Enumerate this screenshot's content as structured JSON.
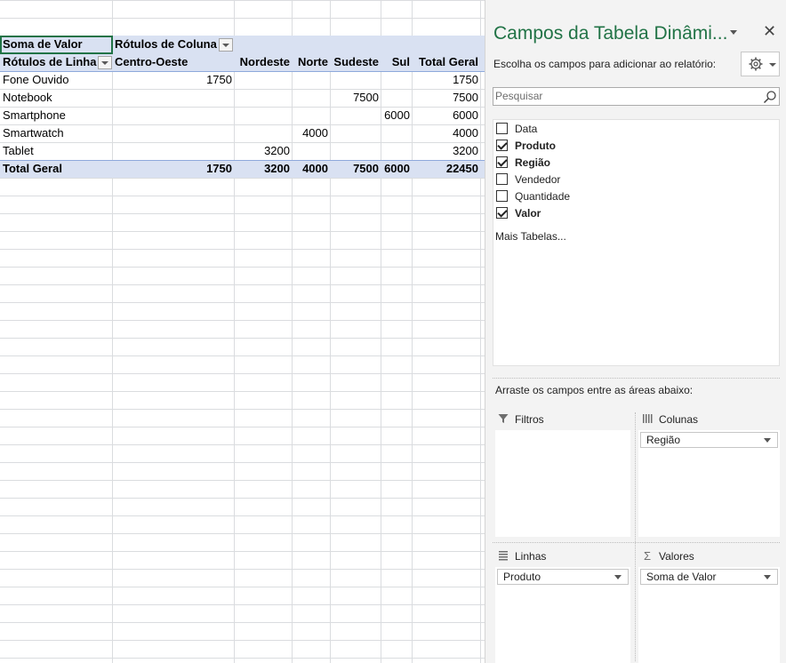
{
  "pivot": {
    "values_header": "Soma de Valor",
    "column_labels_header": "Rótulos de Coluna",
    "row_labels_header": "Rótulos de Linha",
    "columns": [
      "Centro-Oeste",
      "Nordeste",
      "Norte",
      "Sudeste",
      "Sul",
      "Total Geral"
    ],
    "rows": [
      {
        "label": "Fone Ouvido",
        "values": [
          "1750",
          "",
          "",
          "",
          "",
          "1750"
        ]
      },
      {
        "label": "Notebook",
        "values": [
          "",
          "",
          "",
          "7500",
          "",
          "7500"
        ]
      },
      {
        "label": "Smartphone",
        "values": [
          "",
          "",
          "",
          "",
          "6000",
          "6000"
        ]
      },
      {
        "label": "Smartwatch",
        "values": [
          "",
          "",
          "4000",
          "",
          "",
          "4000"
        ]
      },
      {
        "label": "Tablet",
        "values": [
          "",
          "3200",
          "",
          "",
          "",
          "3200"
        ]
      }
    ],
    "total_row": {
      "label": "Total Geral",
      "values": [
        "1750",
        "3200",
        "4000",
        "7500",
        "6000",
        "22450"
      ]
    }
  },
  "panel": {
    "title": "Campos da Tabela Dinâmi...",
    "choose_label": "Escolha os campos para adicionar ao relatório:",
    "search_placeholder": "Pesquisar",
    "fields": [
      {
        "label": "Data",
        "checked": false
      },
      {
        "label": "Produto",
        "checked": true
      },
      {
        "label": "Região",
        "checked": true
      },
      {
        "label": "Vendedor",
        "checked": false
      },
      {
        "label": "Quantidade",
        "checked": false
      },
      {
        "label": "Valor",
        "checked": true
      }
    ],
    "more_tables": "Mais Tabelas...",
    "drag_label": "Arraste os campos entre as áreas abaixo:",
    "areas": {
      "filters": {
        "title": "Filtros",
        "items": []
      },
      "columns": {
        "title": "Colunas",
        "items": [
          "Região"
        ]
      },
      "rows": {
        "title": "Linhas",
        "items": [
          "Produto"
        ]
      },
      "values": {
        "title": "Valores",
        "items": [
          "Soma de Valor"
        ]
      }
    }
  },
  "colors": {
    "accent": "#217346",
    "pivot_header_band": "#d9e1f2",
    "pivot_line": "#8ea9db"
  }
}
